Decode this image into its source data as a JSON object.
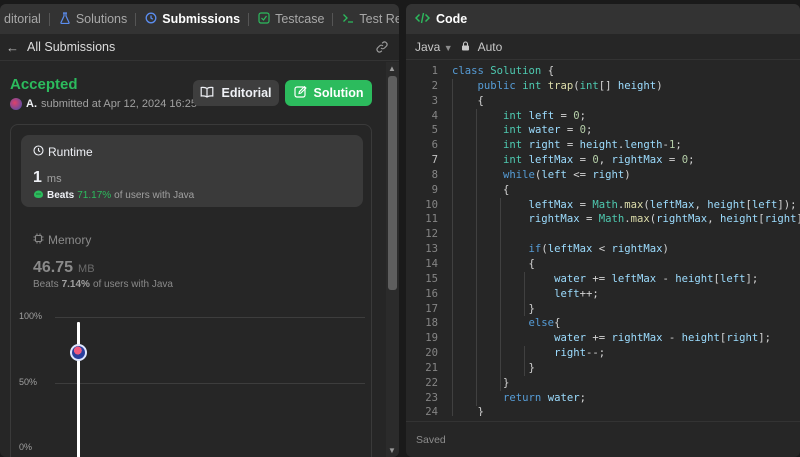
{
  "left_tabs": [
    {
      "label": "ditorial",
      "active": false
    },
    {
      "label": "Solutions",
      "active": false
    },
    {
      "label": "Submissions",
      "active": true
    },
    {
      "label": "Testcase",
      "active": false
    },
    {
      "label": "Test Result",
      "active": false
    }
  ],
  "subheader": {
    "title": "All Submissions"
  },
  "submission": {
    "status": "Accepted",
    "user": "A.",
    "submitted_text": "submitted at Apr 12, 2024 16:25"
  },
  "buttons": {
    "editorial": "Editorial",
    "solution": "Solution"
  },
  "runtime": {
    "title": "Runtime",
    "value": "1",
    "unit": "ms",
    "beats_prefix": "Beats",
    "beats_pct": "71.17%",
    "beats_suffix": "of users with Java"
  },
  "memory": {
    "title": "Memory",
    "value": "46.75",
    "unit": "MB",
    "beats_prefix": "Beats",
    "beats_pct": "7.14%",
    "beats_suffix": "of users with Java"
  },
  "chart_data": {
    "type": "bar",
    "y_ticks": [
      "100%",
      "50%",
      "0%"
    ],
    "ylim": [
      0,
      100
    ],
    "marker_value": 73,
    "grid": true
  },
  "code_panel": {
    "title": "Code",
    "language": "Java",
    "mode": "Auto",
    "footer": "Saved",
    "current_line": 7
  },
  "code_lines": [
    "class Solution {",
    "    public int trap(int[] height)",
    "    {",
    "        int left = 0;",
    "        int water = 0;",
    "        int right = height.length-1;",
    "        int leftMax = 0, rightMax = 0;",
    "        while(left <= right)",
    "        {",
    "            leftMax = Math.max(leftMax, height[left]);",
    "            rightMax = Math.max(rightMax, height[right]);",
    "",
    "            if(leftMax < rightMax)",
    "            {",
    "                water += leftMax - height[left];",
    "                left++;",
    "            }",
    "            else{",
    "                water += rightMax - height[right];",
    "                right--;",
    "            }",
    "        }",
    "        return water;",
    "    }"
  ],
  "colors": {
    "accent_green": "#2cbb5d",
    "panel_bg": "#262626",
    "page_bg": "#1a1a1a"
  }
}
